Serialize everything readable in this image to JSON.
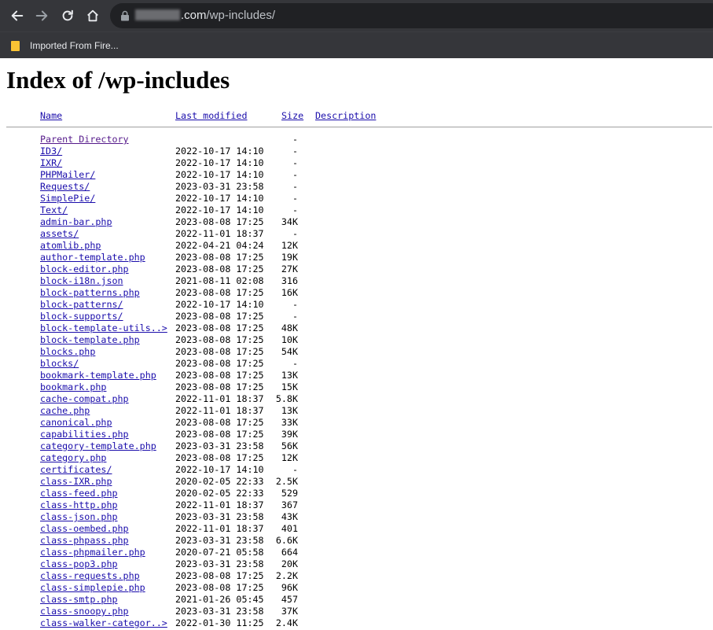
{
  "browser": {
    "url_domain_suffix": ".com",
    "url_path": "/wp-includes/",
    "bookmark": "Imported From Fire..."
  },
  "page": {
    "title": "Index of /wp-includes",
    "headers": {
      "name": "Name",
      "modified": "Last modified",
      "size": "Size",
      "description": "Description"
    }
  },
  "listing": [
    {
      "name": "Parent Directory",
      "date": "",
      "size": "-"
    },
    {
      "name": "ID3/",
      "date": "2022-10-17 14:10",
      "size": "-"
    },
    {
      "name": "IXR/",
      "date": "2022-10-17 14:10",
      "size": "-"
    },
    {
      "name": "PHPMailer/",
      "date": "2022-10-17 14:10",
      "size": "-"
    },
    {
      "name": "Requests/",
      "date": "2023-03-31 23:58",
      "size": "-"
    },
    {
      "name": "SimplePie/",
      "date": "2022-10-17 14:10",
      "size": "-"
    },
    {
      "name": "Text/",
      "date": "2022-10-17 14:10",
      "size": "-"
    },
    {
      "name": "admin-bar.php",
      "date": "2023-08-08 17:25",
      "size": "34K"
    },
    {
      "name": "assets/",
      "date": "2022-11-01 18:37",
      "size": "-"
    },
    {
      "name": "atomlib.php",
      "date": "2022-04-21 04:24",
      "size": "12K"
    },
    {
      "name": "author-template.php",
      "date": "2023-08-08 17:25",
      "size": "19K"
    },
    {
      "name": "block-editor.php",
      "date": "2023-08-08 17:25",
      "size": "27K"
    },
    {
      "name": "block-i18n.json",
      "date": "2021-08-11 02:08",
      "size": "316"
    },
    {
      "name": "block-patterns.php",
      "date": "2023-08-08 17:25",
      "size": "16K"
    },
    {
      "name": "block-patterns/",
      "date": "2022-10-17 14:10",
      "size": "-"
    },
    {
      "name": "block-supports/",
      "date": "2023-08-08 17:25",
      "size": "-"
    },
    {
      "name": "block-template-utils..>",
      "date": "2023-08-08 17:25",
      "size": "48K"
    },
    {
      "name": "block-template.php",
      "date": "2023-08-08 17:25",
      "size": "10K"
    },
    {
      "name": "blocks.php",
      "date": "2023-08-08 17:25",
      "size": "54K"
    },
    {
      "name": "blocks/",
      "date": "2023-08-08 17:25",
      "size": "-"
    },
    {
      "name": "bookmark-template.php",
      "date": "2023-08-08 17:25",
      "size": "13K"
    },
    {
      "name": "bookmark.php",
      "date": "2023-08-08 17:25",
      "size": "15K"
    },
    {
      "name": "cache-compat.php",
      "date": "2022-11-01 18:37",
      "size": "5.8K"
    },
    {
      "name": "cache.php",
      "date": "2022-11-01 18:37",
      "size": "13K"
    },
    {
      "name": "canonical.php",
      "date": "2023-08-08 17:25",
      "size": "33K"
    },
    {
      "name": "capabilities.php",
      "date": "2023-08-08 17:25",
      "size": "39K"
    },
    {
      "name": "category-template.php",
      "date": "2023-03-31 23:58",
      "size": "56K"
    },
    {
      "name": "category.php",
      "date": "2023-08-08 17:25",
      "size": "12K"
    },
    {
      "name": "certificates/",
      "date": "2022-10-17 14:10",
      "size": "-"
    },
    {
      "name": "class-IXR.php",
      "date": "2020-02-05 22:33",
      "size": "2.5K"
    },
    {
      "name": "class-feed.php",
      "date": "2020-02-05 22:33",
      "size": "529"
    },
    {
      "name": "class-http.php",
      "date": "2022-11-01 18:37",
      "size": "367"
    },
    {
      "name": "class-json.php",
      "date": "2023-03-31 23:58",
      "size": "43K"
    },
    {
      "name": "class-oembed.php",
      "date": "2022-11-01 18:37",
      "size": "401"
    },
    {
      "name": "class-phpass.php",
      "date": "2023-03-31 23:58",
      "size": "6.6K"
    },
    {
      "name": "class-phpmailer.php",
      "date": "2020-07-21 05:58",
      "size": "664"
    },
    {
      "name": "class-pop3.php",
      "date": "2023-03-31 23:58",
      "size": "20K"
    },
    {
      "name": "class-requests.php",
      "date": "2023-08-08 17:25",
      "size": "2.2K"
    },
    {
      "name": "class-simplepie.php",
      "date": "2023-08-08 17:25",
      "size": "96K"
    },
    {
      "name": "class-smtp.php",
      "date": "2021-01-26 05:45",
      "size": "457"
    },
    {
      "name": "class-snoopy.php",
      "date": "2023-03-31 23:58",
      "size": "37K"
    },
    {
      "name": "class-walker-categor..>",
      "date": "2022-01-30 11:25",
      "size": "2.4K"
    }
  ]
}
